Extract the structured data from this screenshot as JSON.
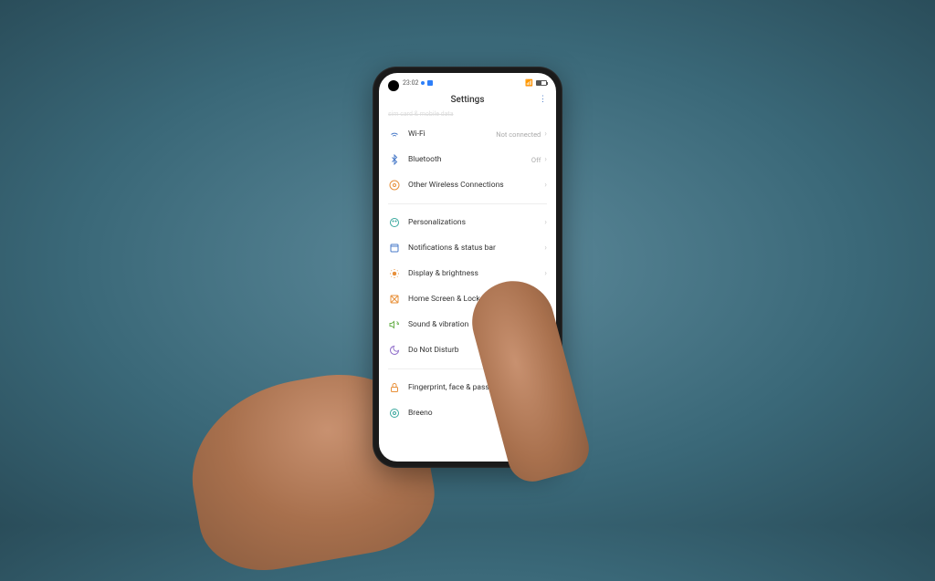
{
  "status_bar": {
    "time": "23:02",
    "signal_indicator": "●"
  },
  "header": {
    "title": "Settings"
  },
  "items": {
    "partial": "sim card & mobile data",
    "wifi": {
      "label": "Wi-Fi",
      "value": "Not connected"
    },
    "bluetooth": {
      "label": "Bluetooth",
      "value": "Off"
    },
    "wireless": {
      "label": "Other Wireless Connections"
    },
    "personal": {
      "label": "Personalizations"
    },
    "notif": {
      "label": "Notifications & status bar"
    },
    "display": {
      "label": "Display & brightness"
    },
    "home": {
      "label": "Home Screen & Lock Screen Magazine"
    },
    "sound": {
      "label": "Sound & vibration"
    },
    "dnd": {
      "label": "Do Not Disturb"
    },
    "finger": {
      "label": "Fingerprint, face & password"
    },
    "breeno": {
      "label": "Breeno"
    }
  },
  "colors": {
    "icon_blue": "#4a7bc9",
    "icon_teal": "#3aa89e",
    "icon_orange": "#e8903a",
    "icon_green": "#6ab04c",
    "icon_purple": "#8e6bc9"
  }
}
